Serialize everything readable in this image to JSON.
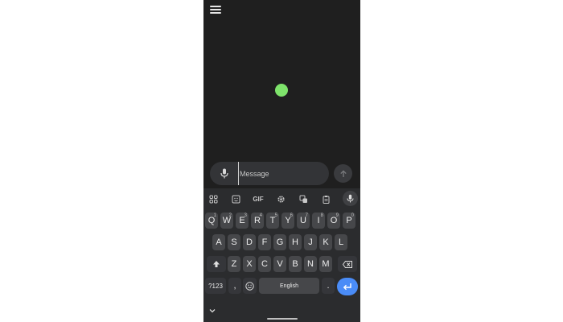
{
  "app": {
    "accent_dot_color": "#7ee36b",
    "enter_key_color": "#4a8cf7"
  },
  "header": {
    "menu_icon": "hamburger-menu-icon"
  },
  "compose": {
    "placeholder": "Message",
    "mic_icon": "microphone-icon",
    "send_icon": "arrow-up-icon"
  },
  "keyboard": {
    "toolbar": [
      {
        "name": "apps-grid-icon"
      },
      {
        "name": "sticker-icon"
      },
      {
        "name": "gif-button",
        "label": "GIF"
      },
      {
        "name": "settings-gear-icon"
      },
      {
        "name": "translate-icon"
      },
      {
        "name": "clipboard-icon"
      },
      {
        "name": "voice-input-icon"
      }
    ],
    "row1": [
      {
        "key": "Q",
        "sup": "1"
      },
      {
        "key": "W",
        "sup": "2"
      },
      {
        "key": "E",
        "sup": "3"
      },
      {
        "key": "R",
        "sup": "4"
      },
      {
        "key": "T",
        "sup": "5"
      },
      {
        "key": "Y",
        "sup": "6"
      },
      {
        "key": "U",
        "sup": "7"
      },
      {
        "key": "I",
        "sup": "8"
      },
      {
        "key": "O",
        "sup": "9"
      },
      {
        "key": "P",
        "sup": "0"
      }
    ],
    "row2": [
      "A",
      "S",
      "D",
      "F",
      "G",
      "H",
      "J",
      "K",
      "L"
    ],
    "row3": [
      "Z",
      "X",
      "C",
      "V",
      "B",
      "N",
      "M"
    ],
    "symbols_label": "?123",
    "comma": ",",
    "period": ".",
    "space_label": "English",
    "shift_icon": "shift-arrow-icon",
    "backspace_icon": "backspace-icon",
    "emoji_icon": "emoji-smiley-icon",
    "enter_icon": "enter-return-icon",
    "hide_icon": "chevron-down-icon"
  }
}
